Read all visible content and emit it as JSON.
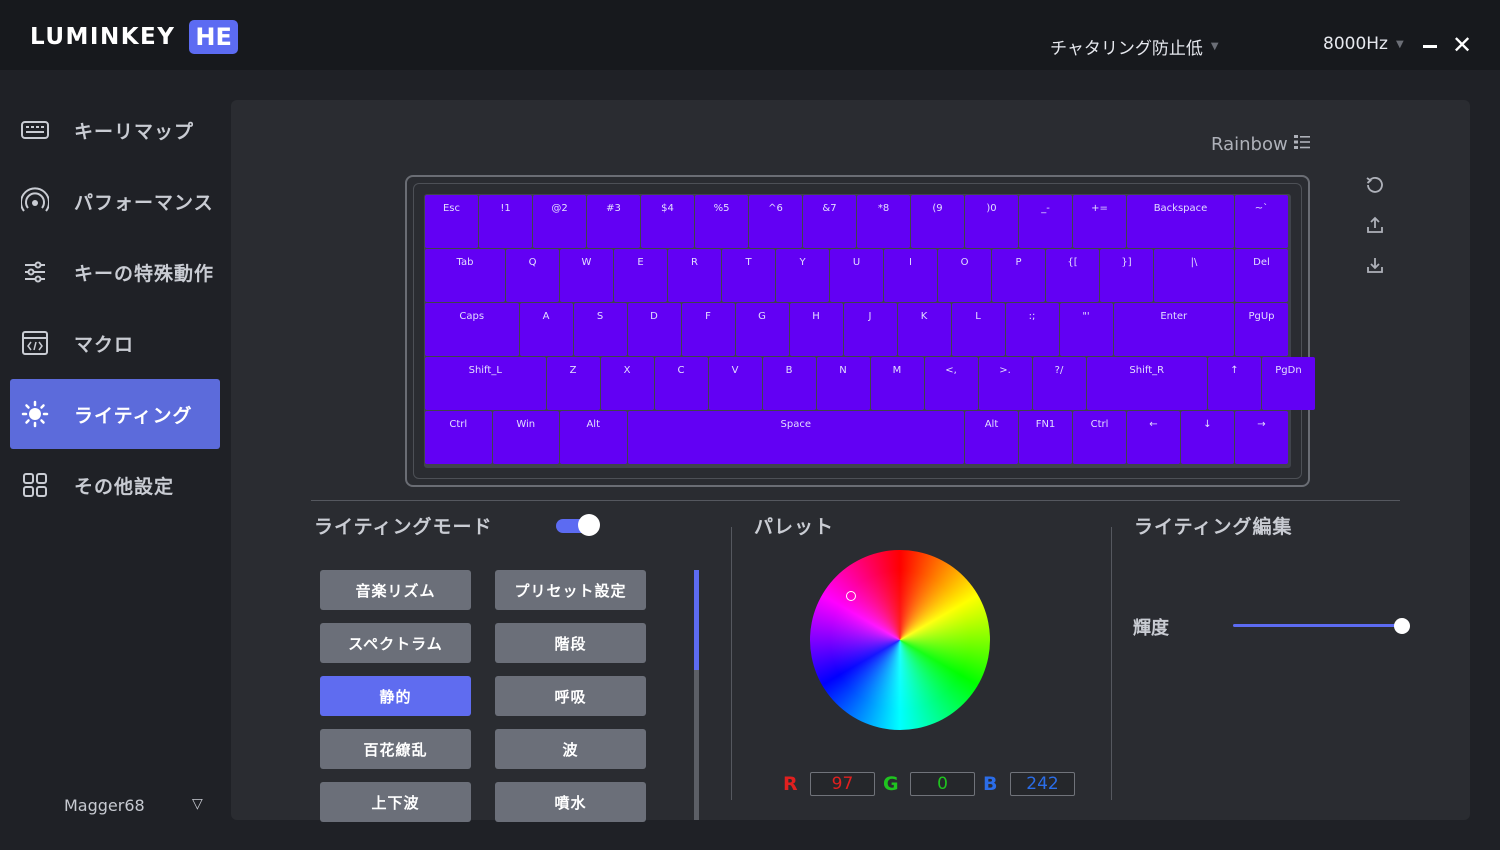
{
  "app": {
    "brand": "LUMINKEY",
    "badge": "HE"
  },
  "titlebar": {
    "antichatter": "チャタリング防止低",
    "polling_rate": "8000Hz"
  },
  "sidebar": {
    "items": [
      {
        "label": "キーリマップ",
        "icon": "keyboard-icon"
      },
      {
        "label": "パフォーマンス",
        "icon": "signal-icon"
      },
      {
        "label": "キーの特殊動作",
        "icon": "sliders-icon"
      },
      {
        "label": "マクロ",
        "icon": "code-icon"
      },
      {
        "label": "ライティング",
        "icon": "sun-icon"
      },
      {
        "label": "その他設定",
        "icon": "grid-icon"
      }
    ],
    "active_index": 4,
    "device": "Magger68"
  },
  "preset": "Rainbow",
  "keyboard": {
    "key_color": "#6200f4",
    "rows": [
      [
        "Esc",
        "!1",
        "@2",
        "#3",
        "$4",
        "%5",
        "^6",
        "&7",
        "*8",
        "(9",
        ")0",
        "_-",
        "+=",
        "Backspace",
        "~`"
      ],
      [
        "Tab",
        "Q",
        "W",
        "E",
        "R",
        "T",
        "Y",
        "U",
        "I",
        "O",
        "P",
        "{[",
        "}]",
        "|\\",
        "Del"
      ],
      [
        "Caps",
        "A",
        "S",
        "D",
        "F",
        "G",
        "H",
        "J",
        "K",
        "L",
        ":;",
        "\"'",
        "Enter",
        "PgUp"
      ],
      [
        "Shift_L",
        "Z",
        "X",
        "C",
        "V",
        "B",
        "N",
        "M",
        "<,",
        ">.",
        "?/",
        "Shift_R",
        "↑",
        "PgDn"
      ],
      [
        "Ctrl",
        "Win",
        "Alt",
        "Space",
        "Alt",
        "FN1",
        "Ctrl",
        "←",
        "↓",
        "→"
      ]
    ]
  },
  "lighting_mode": {
    "title": "ライティングモード",
    "enabled": true,
    "modes": [
      "音楽リズム",
      "プリセット設定",
      "スペクトラム",
      "階段",
      "静的",
      "呼吸",
      "百花繚乱",
      "波",
      "上下波",
      "噴水"
    ],
    "active_mode": "静的"
  },
  "palette": {
    "title": "パレット",
    "r_label": "R",
    "g_label": "G",
    "b_label": "B",
    "r": "97",
    "g": "0",
    "b": "242",
    "r_color": "#e0201f",
    "g_color": "#1fc41f",
    "b_color": "#2b6de8"
  },
  "lighting_edit": {
    "title": "ライティング編集",
    "brightness_label": "輝度",
    "brightness": 1.0
  },
  "colors": {
    "accent": "#5c6bf2"
  }
}
